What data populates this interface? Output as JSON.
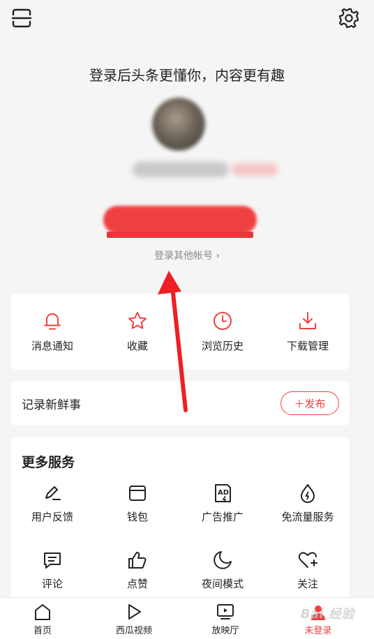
{
  "header": {
    "scan_icon": "scan-icon",
    "settings_icon": "gear-icon"
  },
  "login": {
    "title": "登录后头条更懂你，内容更有趣",
    "other_account": "登录其他帐号 ›"
  },
  "quick_actions": [
    {
      "label": "消息通知",
      "icon": "bell-icon"
    },
    {
      "label": "收藏",
      "icon": "star-icon"
    },
    {
      "label": "浏览历史",
      "icon": "clock-icon"
    },
    {
      "label": "下载管理",
      "icon": "download-icon"
    }
  ],
  "post": {
    "title": "记录新鲜事",
    "button": "＋发布"
  },
  "services": {
    "title": "更多服务",
    "items": [
      {
        "label": "用户反馈",
        "icon": "pen-icon"
      },
      {
        "label": "钱包",
        "icon": "wallet-icon"
      },
      {
        "label": "广告推广",
        "icon": "ad-icon"
      },
      {
        "label": "免流量服务",
        "icon": "drop-icon"
      },
      {
        "label": "评论",
        "icon": "comment-icon"
      },
      {
        "label": "点赞",
        "icon": "thumbs-up-icon"
      },
      {
        "label": "夜间模式",
        "icon": "moon-icon"
      },
      {
        "label": "关注",
        "icon": "heart-plus-icon"
      }
    ]
  },
  "bottom_nav": [
    {
      "label": "首页",
      "icon": "home-icon"
    },
    {
      "label": "西瓜视频",
      "icon": "play-icon"
    },
    {
      "label": "放映厅",
      "icon": "screen-play-icon"
    },
    {
      "label": "未登录",
      "icon": "user-icon",
      "active": true
    }
  ],
  "watermark": "Bai 经验",
  "colors": {
    "accent": "#f04142",
    "background": "#f5f5f5",
    "card": "#ffffff"
  }
}
